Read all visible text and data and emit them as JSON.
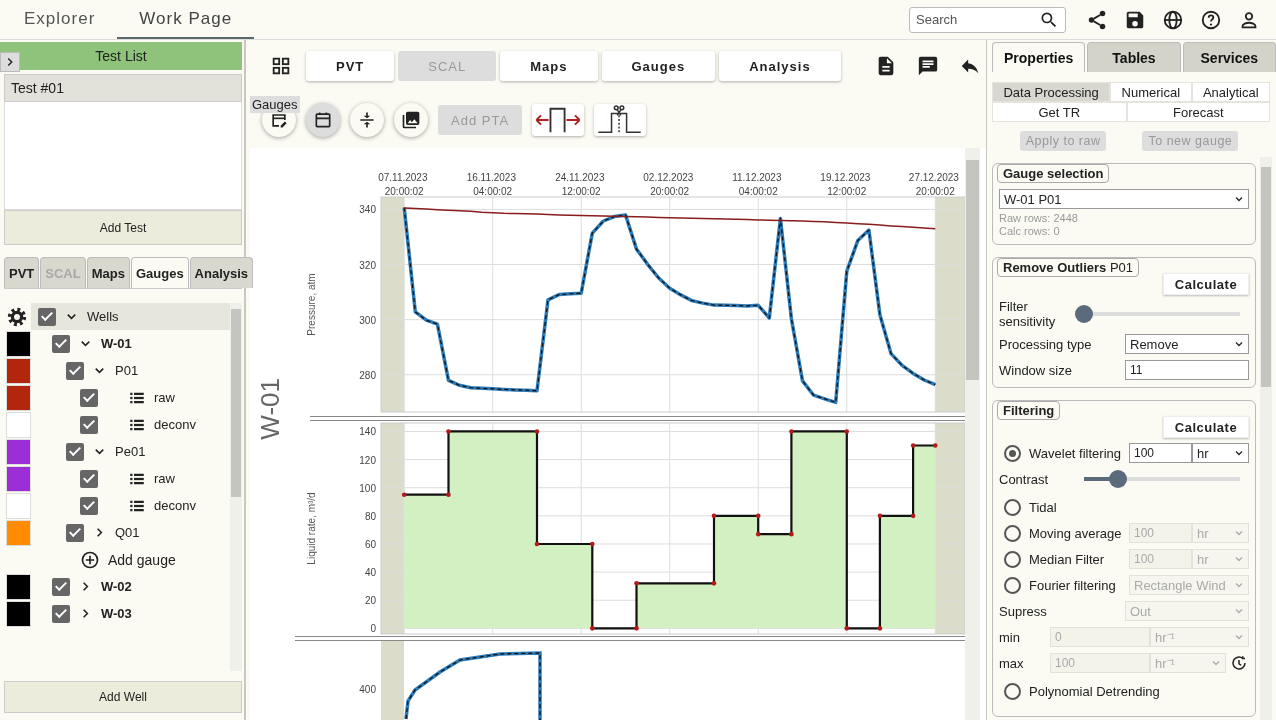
{
  "top_bar": {
    "tabs": [
      {
        "label": "Explorer",
        "selected": false
      },
      {
        "label": "Work Page",
        "selected": true
      }
    ],
    "search": {
      "placeholder": "Search"
    }
  },
  "left_panel": {
    "title": "Test List",
    "tests": [
      {
        "label": "Test #01",
        "selected": true
      }
    ],
    "add_test": "Add Test",
    "tabs": [
      {
        "label": "PVT",
        "selected": false,
        "disabled": false
      },
      {
        "label": "SCAL",
        "selected": false,
        "disabled": true
      },
      {
        "label": "Maps",
        "selected": false,
        "disabled": false
      },
      {
        "label": "Gauges",
        "selected": true,
        "disabled": false
      },
      {
        "label": "Analysis",
        "selected": false,
        "disabled": false
      }
    ],
    "tree": {
      "label": "Wells",
      "checked": true,
      "expanded": true,
      "children": [
        {
          "kind": "well",
          "label": "W-01",
          "color": "#000000",
          "checked": true,
          "expanded": true,
          "children": [
            {
              "kind": "gauge",
              "label": "P01",
              "color": "#b3260e",
              "checked": true,
              "expanded": true,
              "children": [
                {
                  "kind": "series",
                  "label": "raw",
                  "color": "#b3260e",
                  "checked": true
                },
                {
                  "kind": "series",
                  "label": "deconv",
                  "color": "#ffffff",
                  "checked": true
                }
              ]
            },
            {
              "kind": "gauge",
              "label": "Pe01",
              "color": "#9b2fd6",
              "checked": true,
              "expanded": true,
              "children": [
                {
                  "kind": "series",
                  "label": "raw",
                  "color": "#9b2fd6",
                  "checked": true
                },
                {
                  "kind": "series",
                  "label": "deconv",
                  "color": "#ffffff",
                  "checked": true
                }
              ]
            },
            {
              "kind": "gauge",
              "label": "Q01",
              "color": "#ff8c00",
              "checked": true,
              "expanded": false
            },
            {
              "kind": "add",
              "label": "Add gauge"
            }
          ]
        },
        {
          "kind": "well",
          "label": "W-02",
          "color": "#000000",
          "checked": true,
          "expanded": false
        },
        {
          "kind": "well",
          "label": "W-03",
          "color": "#000000",
          "checked": true,
          "expanded": false
        }
      ]
    },
    "add_well": "Add Well"
  },
  "workspace": {
    "tabs": [
      {
        "label": "PVT",
        "disabled": false
      },
      {
        "label": "SCAL",
        "disabled": true
      },
      {
        "label": "Maps",
        "disabled": false
      },
      {
        "label": "Gauges",
        "disabled": false
      },
      {
        "label": "Analysis",
        "disabled": false
      }
    ],
    "tools": [
      {
        "kind": "edit-calendar",
        "pressed": false
      },
      {
        "kind": "calendar",
        "pressed": true
      },
      {
        "kind": "compress",
        "pressed": false
      },
      {
        "kind": "image",
        "pressed": false
      }
    ],
    "tooltip": "Gauges",
    "add_pta": {
      "label": "Add PTA",
      "disabled": true
    },
    "well_label": "W-01",
    "pressure_chart": {
      "chart_data": {
        "type": "line",
        "ylabel": "Pressure, atm",
        "grid": true,
        "ylim": [
          266.5,
          344.5
        ],
        "yticks": [
          280,
          300,
          320,
          340
        ],
        "categories": [
          "07.11.2023 20:00:02",
          null,
          null,
          null,
          null,
          null,
          null,
          null,
          "16.11.2023 04:00:02",
          null,
          null,
          null,
          null,
          null,
          null,
          null,
          "24.11.2023 12:00:02",
          null,
          null,
          null,
          null,
          null,
          null,
          null,
          "02.12.2023 20:00:02",
          null,
          null,
          null,
          null,
          null,
          null,
          null,
          "11.12.2023 04:00:02",
          null,
          null,
          null,
          null,
          null,
          null,
          null,
          "19.12.2023 12:00:02",
          null,
          null,
          null,
          null,
          null,
          null,
          null,
          "27.12.2023 20:00:02"
        ],
        "series": [
          {
            "color": "#2b7bb9",
            "values": [
              340.7,
              302.8,
              299.8,
              298.4,
              278.0,
              276.2,
              275.3,
              275.1,
              274.9,
              274.7,
              274.5,
              274.4,
              274.2,
              307.2,
              309.1,
              309.4,
              309.6,
              331.4,
              335.8,
              337.4,
              338.0,
              325.6,
              320.1,
              315.1,
              311.4,
              309.0,
              306.9,
              306.0,
              305.3,
              305.2,
              305.1,
              305.0,
              305.2,
              300.6,
              336.7,
              300.3,
              277.8,
              272.6,
              271.3,
              270.0,
              317.6,
              328.7,
              332.5,
              301.8,
              287.7,
              283.4,
              280.5,
              278.1,
              276.4
            ]
          },
          {
            "color": "#8b1c1c",
            "values": [
              340.5,
              340.3,
              340.1,
              339.9,
              339.7,
              339.5,
              339.3,
              339.0,
              338.8,
              338.6,
              338.5,
              338.4,
              338.3,
              338.1,
              338.0,
              337.9,
              337.8,
              337.7,
              337.6,
              337.5,
              337.4,
              337.3,
              337.2,
              337.1,
              337.0,
              336.9,
              336.8,
              336.7,
              336.6,
              336.5,
              336.4,
              336.3,
              336.2,
              336.1,
              336.0,
              335.9,
              335.8,
              335.6,
              335.5,
              335.3,
              335.1,
              334.8,
              334.6,
              334.3,
              334.0,
              333.8,
              333.5,
              333.3,
              333.0
            ]
          }
        ]
      }
    },
    "rate_chart": {
      "chart_data": {
        "type": "area",
        "ylabel": "Liquid rate, m³/d",
        "grid": true,
        "ylim": [
          -4,
          146
        ],
        "yticks": [
          0,
          20,
          40,
          60,
          80,
          100,
          120,
          140
        ],
        "categories": [
          null,
          null,
          null,
          null,
          null,
          null,
          null,
          null,
          null,
          null,
          null,
          null,
          null,
          null,
          null,
          null,
          null,
          null,
          null,
          null,
          null,
          null,
          null,
          null,
          null,
          null,
          null,
          null,
          null,
          null,
          null,
          null,
          null,
          null,
          null,
          null,
          null,
          null,
          null,
          null,
          null,
          null,
          null,
          null,
          null,
          null,
          null,
          null,
          null
        ],
        "series": [
          {
            "color": "#d3f0c2",
            "values": [
              95,
              95,
              95,
              95,
              140,
              140,
              140,
              140,
              140,
              140,
              140,
              140,
              60,
              60,
              60,
              60,
              60,
              0,
              0,
              0,
              0,
              32,
              32,
              32,
              32,
              32,
              32,
              32,
              80,
              80,
              80,
              80,
              67,
              67,
              67,
              140,
              140,
              140,
              140,
              140,
              0,
              0,
              0,
              80,
              80,
              80,
              130,
              130,
              130
            ]
          }
        ]
      }
    },
    "third_chart": {
      "ytick": "400"
    }
  },
  "right_panel": {
    "tabs": [
      {
        "label": "Properties",
        "selected": true
      },
      {
        "label": "Tables",
        "selected": false
      },
      {
        "label": "Services",
        "selected": false
      }
    ],
    "subtabs": [
      [
        {
          "label": "Data Processing",
          "selected": true
        },
        {
          "label": "Numerical",
          "selected": false
        },
        {
          "label": "Analytical",
          "selected": false
        }
      ],
      [
        {
          "label": "Get TR",
          "selected": false
        },
        {
          "label": "Forecast",
          "selected": false
        }
      ]
    ],
    "actions": [
      {
        "label": "Apply to raw",
        "disabled": true
      },
      {
        "label": "To new gauge",
        "disabled": true
      }
    ],
    "gauge_selection": {
      "title": "Gauge selection",
      "value": "W-01 P01",
      "info": [
        "Raw rows: 2448",
        "Calc rows: 0"
      ]
    },
    "remove_outliers": {
      "title": "**Remove Outliers** P01",
      "button": "Calculate",
      "rows": [
        {
          "kind": "slider",
          "label": "Filter sensitivity",
          "level": 0
        },
        {
          "kind": "select",
          "label": "Processing type",
          "value": "Remove"
        },
        {
          "kind": "input",
          "label": "Window size",
          "value": "11"
        }
      ]
    },
    "filtering": {
      "title": "Filtering",
      "button": "Calculate",
      "rows": [
        {
          "kind": "radio",
          "label": "Wavelet filtering",
          "selected": true,
          "value": "100",
          "unit": "hr",
          "disabled": false
        },
        {
          "kind": "slider",
          "label": "Contrast",
          "level": 0.22
        },
        {
          "kind": "radio",
          "label": "Tidal",
          "selected": false
        },
        {
          "kind": "radio",
          "label": "Moving average",
          "selected": false,
          "value": "100",
          "unit": "hr",
          "disabled": true
        },
        {
          "kind": "radio",
          "label": "Median Filter",
          "selected": false,
          "value": "100",
          "unit": "hr",
          "disabled": true
        },
        {
          "kind": "radio",
          "label": "Fourier filtering",
          "selected": false,
          "option": "Rectangle Wind",
          "disabled": true
        },
        {
          "kind": "select",
          "label": "Supress",
          "value": "Out",
          "disabled": true
        },
        {
          "kind": "range",
          "label": "min",
          "value": "0",
          "unit": "hr⁻¹",
          "disabled": true,
          "reset": false
        },
        {
          "kind": "range",
          "label": "max",
          "value": "100",
          "unit": "hr⁻¹",
          "disabled": true,
          "reset": true
        },
        {
          "kind": "radio",
          "label": "Polynomial Detrending",
          "selected": false
        }
      ]
    }
  }
}
